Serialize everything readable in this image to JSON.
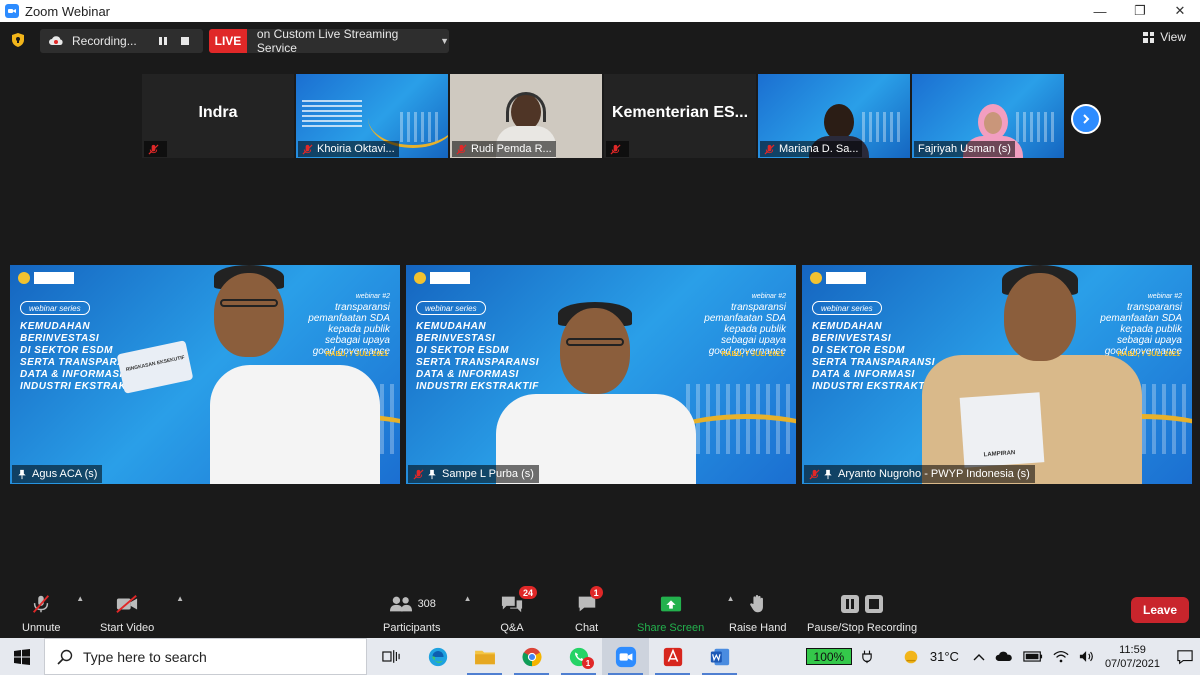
{
  "window": {
    "title": "Zoom Webinar"
  },
  "topbar": {
    "recording_label": "Recording...",
    "live_badge": "LIVE",
    "live_service": "on Custom Live Streaming Service",
    "view_label": "View"
  },
  "gallery": [
    {
      "name": "Indra",
      "kind": "name-only"
    },
    {
      "name": "Khoiria Oktavi...",
      "kind": "poster"
    },
    {
      "name": "Rudi Pemda R...",
      "kind": "camera"
    },
    {
      "name": "Kementerian  ES...",
      "kind": "name-only"
    },
    {
      "name": "Mariana D. Sa...",
      "kind": "camera"
    },
    {
      "name": "Fajriyah Usman (s)",
      "kind": "camera"
    }
  ],
  "poster": {
    "series": "webinar series",
    "webinar_no": "webinar #2",
    "headline": [
      "KEMUDAHAN",
      "BERINVESTASI",
      "DI SEKTOR ESDM",
      "SERTA TRANSPARANSI",
      "DATA & INFORMASI",
      "INDUSTRI EKSTRAKTIF"
    ],
    "right": [
      "transparansi",
      "pemanfaatan SDA",
      "kepada publik",
      "sebagai upaya",
      "good governance"
    ],
    "date": "RABU, 7 JULI 2021",
    "booklet_text": "RINGKASAN EKSEKUTIF",
    "paper_text": "LAMPIRAN"
  },
  "speakers": [
    {
      "name": "Agus ACA (s)"
    },
    {
      "name": "Sampe L Purba (s)"
    },
    {
      "name": "Aryanto Nugroho - PWYP Indonesia (s)"
    }
  ],
  "toolbar": {
    "unmute": "Unmute",
    "start_video": "Start Video",
    "participants": "Participants",
    "participants_count": "308",
    "qa": "Q&A",
    "qa_badge": "24",
    "chat": "Chat",
    "chat_badge": "1",
    "share_screen": "Share Screen",
    "raise_hand": "Raise Hand",
    "pause_stop": "Pause/Stop Recording",
    "leave": "Leave"
  },
  "taskbar": {
    "search_placeholder": "Type here to search",
    "whatsapp_badge": "1",
    "battery": "100%",
    "temperature": "31°C",
    "time": "11:59",
    "date": "07/07/2021"
  },
  "colors": {
    "zoom_blue": "#2d8cff",
    "live_red": "#e02828",
    "leave_red": "#c9252c",
    "share_green": "#23b14d",
    "poster_blue": "#1b6fd1",
    "poster_gold": "#e8b12a"
  }
}
